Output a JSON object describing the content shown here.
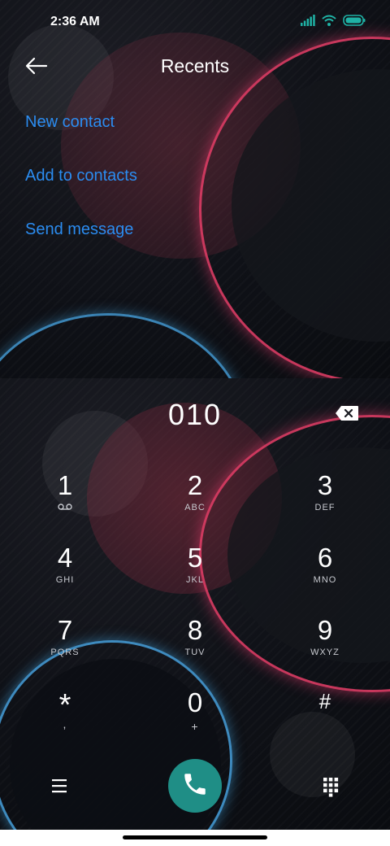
{
  "status_bar": {
    "time": "2:36 AM"
  },
  "header": {
    "title": "Recents"
  },
  "menu": {
    "items": [
      {
        "label": "New contact"
      },
      {
        "label": "Add to contacts"
      },
      {
        "label": "Send message"
      }
    ]
  },
  "dialer": {
    "number": "010",
    "keys": [
      {
        "digit": "1",
        "letters": ""
      },
      {
        "digit": "2",
        "letters": "ABC"
      },
      {
        "digit": "3",
        "letters": "DEF"
      },
      {
        "digit": "4",
        "letters": "GHI"
      },
      {
        "digit": "5",
        "letters": "JKL"
      },
      {
        "digit": "6",
        "letters": "MNO"
      },
      {
        "digit": "7",
        "letters": "PQRS"
      },
      {
        "digit": "8",
        "letters": "TUV"
      },
      {
        "digit": "9",
        "letters": "WXYZ"
      },
      {
        "digit": "*",
        "letters": ","
      },
      {
        "digit": "0",
        "letters": "+"
      },
      {
        "digit": "#",
        "letters": ""
      }
    ]
  },
  "colors": {
    "link": "#2b8cf0",
    "call": "#1f8e86",
    "battery": "#1fb2a5"
  },
  "icons": [
    "back-arrow-icon",
    "signal-icon",
    "wifi-icon",
    "battery-icon",
    "backspace-icon",
    "voicemail-icon",
    "menu-icon",
    "phone-icon",
    "dialpad-icon"
  ]
}
